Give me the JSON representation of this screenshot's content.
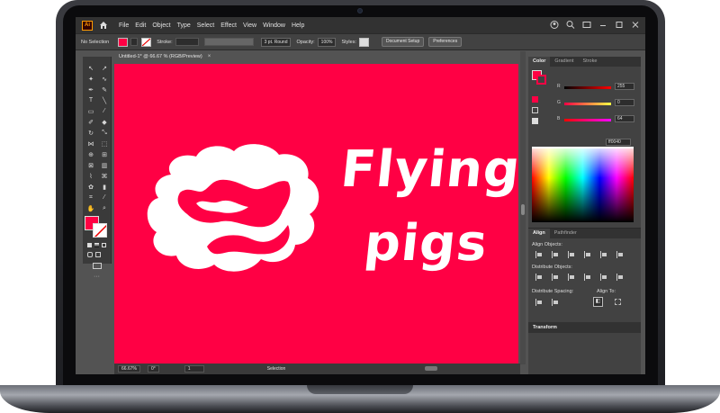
{
  "menubar": {
    "app_logo": "Ai",
    "items": [
      "File",
      "Edit",
      "Object",
      "Type",
      "Select",
      "Effect",
      "View",
      "Window",
      "Help"
    ]
  },
  "controlbar": {
    "selection": "No Selection",
    "stroke_label": "Stroke:",
    "brush": "3 pt. Round",
    "opacity_label": "Opacity:",
    "opacity_value": "100%",
    "styles_label": "Styles:",
    "document_setup": "Document Setup",
    "preferences": "Preferences"
  },
  "document": {
    "tab_title": "Untitled-1* @ 66.67 % (RGB/Preview)",
    "tab_close": "×"
  },
  "artwork": {
    "line1": "Flying",
    "line2": "pigs",
    "background": "#ff0044"
  },
  "statusbar": {
    "zoom": "66.67%",
    "rotation": "0°",
    "artboard": "1",
    "tool": "Selection"
  },
  "panels": {
    "color_tabs": [
      "Color",
      "Gradient",
      "Stroke"
    ],
    "r_value": "255",
    "g_value": "0",
    "b_value": "64",
    "hex_value": "ff0040",
    "align_tabs": [
      "Align",
      "Pathfinder"
    ],
    "align_objects": "Align Objects:",
    "distribute_objects": "Distribute Objects:",
    "distribute_spacing": "Distribute Spacing:",
    "align_to": "Align To:",
    "transform_title": "Transform"
  },
  "colors": {
    "accent": "#ff0044",
    "ui_dark": "#323232",
    "ui_mid": "#535353"
  }
}
